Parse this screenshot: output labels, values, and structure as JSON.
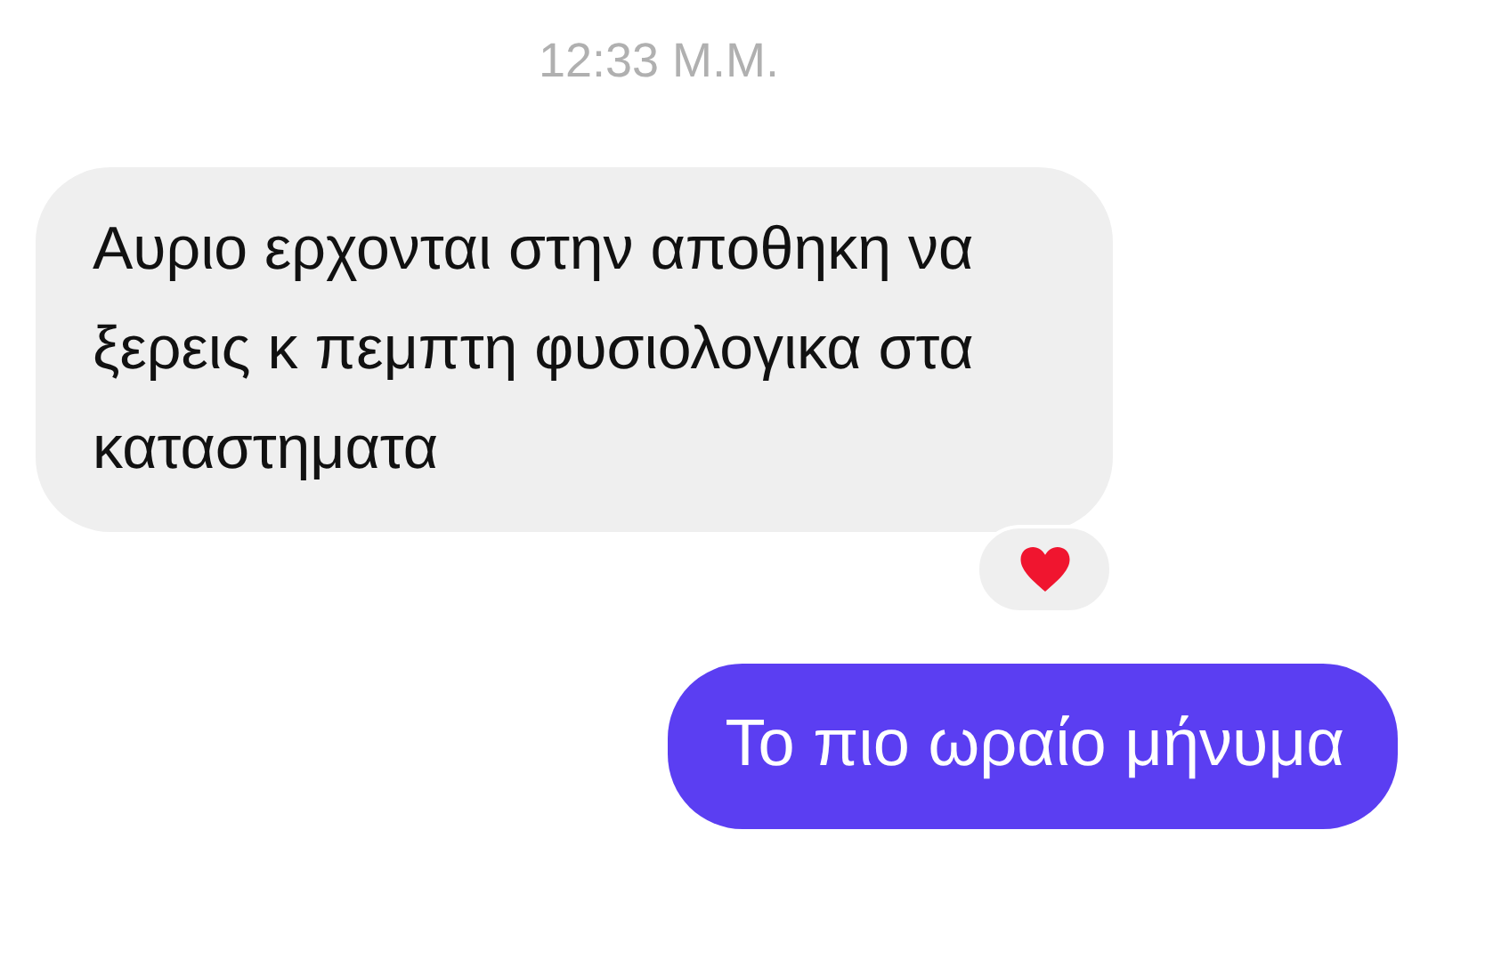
{
  "timestamp": "12:33 Μ.Μ.",
  "messages": [
    {
      "kind": "incoming",
      "text": "Αυριο ερχονται στην αποθηκη να ξερεις κ πεμπτη φυσιολογικα στα καταστηματα",
      "liked": true
    },
    {
      "kind": "outgoing",
      "text": "Το πιο ωραίο μήνυμα",
      "liked": false
    }
  ]
}
